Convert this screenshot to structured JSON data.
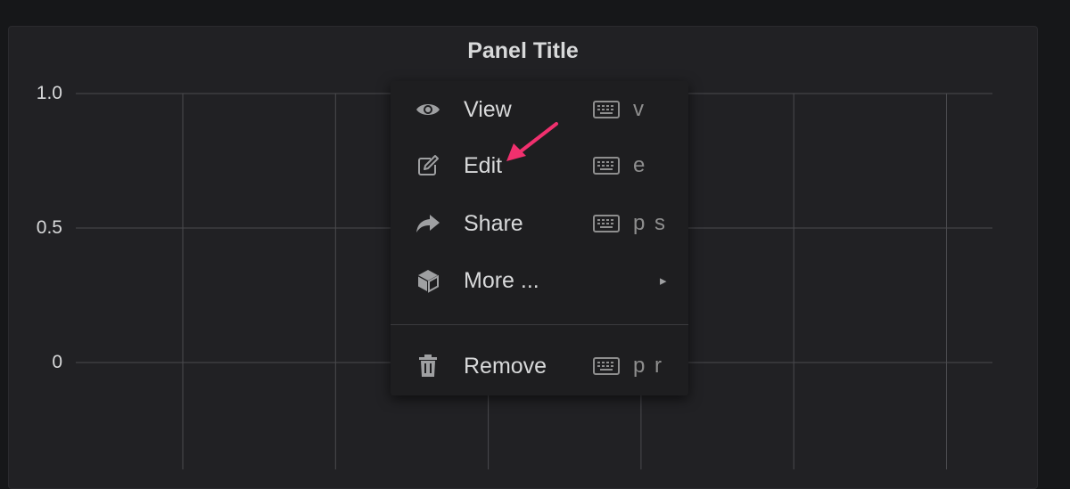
{
  "panel": {
    "title": "Panel Title"
  },
  "chart_data": {
    "type": "line",
    "title": "Panel Title",
    "xlabel": "",
    "ylabel": "",
    "ylim": [
      0,
      1.0
    ],
    "y_ticks": [
      "1.0",
      "0.5",
      "0"
    ],
    "grid": true,
    "series": []
  },
  "context_menu": {
    "items": [
      {
        "label": "View",
        "icon": "eye-icon",
        "shortcut": "v"
      },
      {
        "label": "Edit",
        "icon": "edit-icon",
        "shortcut": "e"
      },
      {
        "label": "Share",
        "icon": "share-icon",
        "shortcut": "p s"
      },
      {
        "label": "More ...",
        "icon": "cube-icon",
        "submenu_arrow": "▸"
      },
      {
        "label": "Remove",
        "icon": "trash-icon",
        "shortcut": "p r"
      }
    ]
  },
  "annotation": {
    "arrow_color": "#f0306e"
  },
  "colors": {
    "background": "#161719",
    "panel": "#212124",
    "menu": "#1e1e20",
    "text": "#d8d9da",
    "muted": "#8e8e8e",
    "grid": "#4a4a4e"
  }
}
